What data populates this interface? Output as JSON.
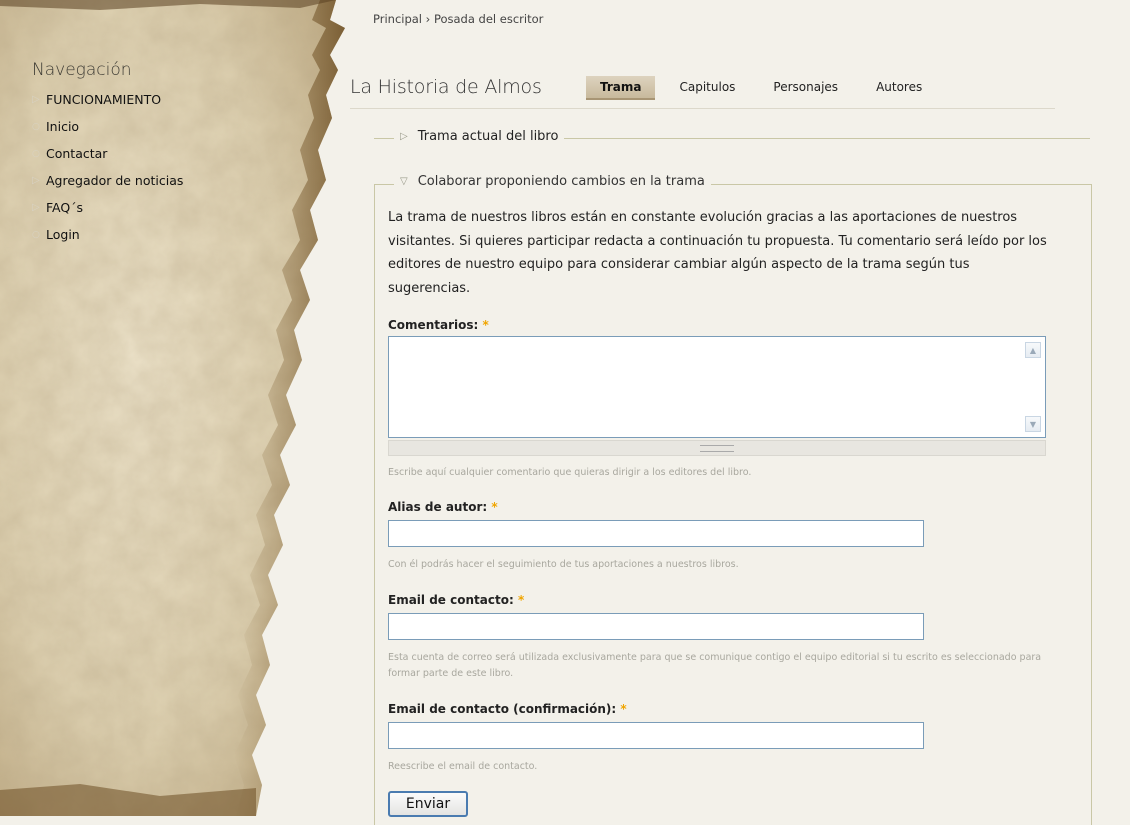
{
  "navigation": {
    "title": "Navegación",
    "items": [
      {
        "label": "FUNCIONAMIENTO",
        "icon": "triangle-right-icon"
      },
      {
        "label": "Inicio",
        "icon": "circle-bullet-icon"
      },
      {
        "label": "Contactar",
        "icon": "circle-bullet-icon"
      },
      {
        "label": "Agregador de noticias",
        "icon": "triangle-right-icon"
      },
      {
        "label": "FAQ´s",
        "icon": "triangle-right-icon"
      },
      {
        "label": "Login",
        "icon": "circle-bullet-icon"
      }
    ]
  },
  "breadcrumb": {
    "home": "Principal",
    "separator": "›",
    "current": "Posada del escritor"
  },
  "page": {
    "title": "La Historia de Almos"
  },
  "tabs": [
    {
      "label": "Trama",
      "active": true
    },
    {
      "label": "Capitulos",
      "active": false
    },
    {
      "label": "Personajes",
      "active": false
    },
    {
      "label": "Autores",
      "active": false
    }
  ],
  "fieldsets": {
    "current_plot": {
      "legend": "Trama actual del libro",
      "collapsed": true
    },
    "collaborate": {
      "legend": "Colaborar proponiendo cambios en la trama",
      "collapsed": false
    }
  },
  "form": {
    "intro": "La trama de nuestros libros están en constante evolución gracias a las aportaciones de nuestros visitantes. Si quieres participar redacta a continuación tu propuesta. Tu comentario será leído por los editores de nuestro equipo para considerar cambiar algún aspecto de la trama según tus sugerencias.",
    "required_mark": "*",
    "comments": {
      "label": "Comentarios:",
      "value": "",
      "help": "Escribe aquí cualquier comentario que quieras dirigir a los editores del libro."
    },
    "alias": {
      "label": "Alias de autor:",
      "value": "",
      "help": "Con él podrás hacer el seguimiento de tus aportaciones a nuestros libros."
    },
    "email": {
      "label": "Email de contacto:",
      "value": "",
      "help": "Esta cuenta de correo será utilizada exclusivamente para que se comunique contigo el equipo editorial si tu escrito es seleccionado para formar parte de este libro."
    },
    "email_confirm": {
      "label": "Email de contacto (confirmación):",
      "value": "",
      "help": "Reescribe el email de contacto."
    },
    "submit_label": "Enviar"
  },
  "colors": {
    "accent_required": "#f0a500",
    "fieldset_border": "#c9c7a6",
    "input_border": "#7a9cb8"
  }
}
